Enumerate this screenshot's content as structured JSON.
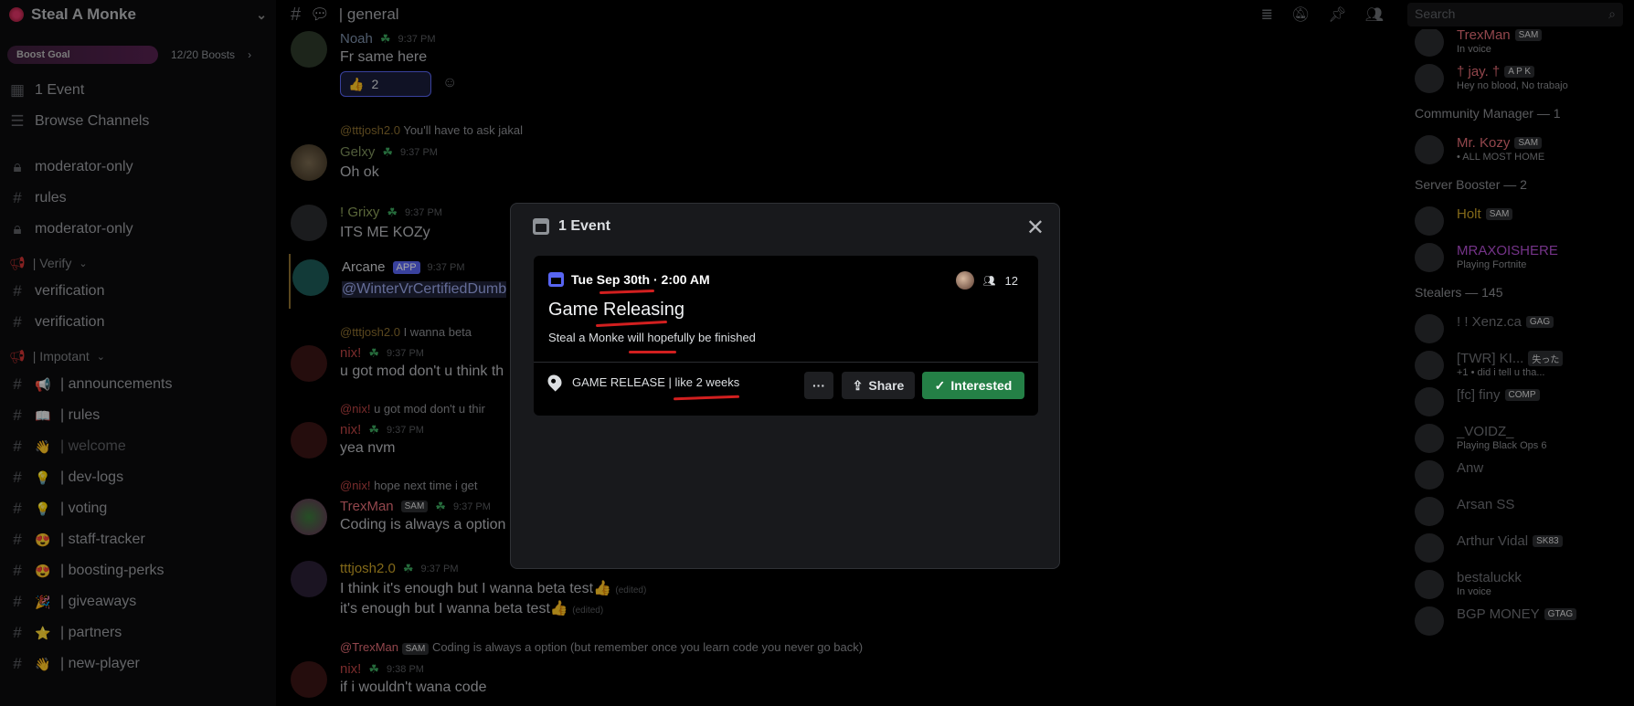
{
  "server": {
    "name": "Steal A Monke",
    "boost_label": "Boost Goal",
    "boost_count": "12/20 Boosts"
  },
  "sidebar": {
    "top_items": [
      {
        "label": "1 Event",
        "icon": "calendar-icon"
      },
      {
        "label": "Browse Channels",
        "icon": "browse-icon"
      }
    ],
    "channels_a": [
      {
        "label": "moderator-only",
        "icon": "lock-icon"
      },
      {
        "label": "rules",
        "icon": "hash-icon"
      },
      {
        "label": "moderator-only",
        "icon": "lock-icon"
      }
    ],
    "cat_verify": "| Verify",
    "channels_verify": [
      "verification",
      "verification"
    ],
    "cat_impotant": "| Impotant",
    "channels_impotant": [
      {
        "emoji": "📢",
        "label": "| announcements"
      },
      {
        "emoji": "📖",
        "label": "| rules"
      },
      {
        "emoji": "👋",
        "label": "| welcome"
      },
      {
        "emoji": "💡",
        "label": "| dev-logs"
      },
      {
        "emoji": "💡",
        "label": "| voting"
      },
      {
        "emoji": "😍",
        "label": "| staff-tracker"
      },
      {
        "emoji": "😍",
        "label": "| boosting-perks"
      },
      {
        "emoji": "🎉",
        "label": "| giveaways"
      },
      {
        "emoji": "⭐",
        "label": "| partners"
      },
      {
        "emoji": "👋",
        "label": "| new-player"
      }
    ]
  },
  "topbar": {
    "channel": "| general",
    "search_placeholder": "Search"
  },
  "messages": [
    {
      "author": "Noah",
      "time": "9:37 PM",
      "text": "Fr same here",
      "reaction_count": "2"
    },
    {
      "reply_who": "@tttjosh2.0",
      "reply_text": "You'll have to ask jakal",
      "author": "Gelxy",
      "time": "9:37 PM",
      "text": "Oh ok"
    },
    {
      "author": "! Grixy",
      "time": "9:37 PM",
      "text": "ITS ME KOZy"
    },
    {
      "author": "Arcane",
      "app": "APP",
      "time": "9:37 PM",
      "text": "@WinterVrCertifiedDumb"
    },
    {
      "reply_who": "@tttjosh2.0",
      "reply_text": "I wanna beta",
      "author": "nix!",
      "time": "9:37 PM",
      "text": "u got mod don't u think th"
    },
    {
      "reply_who": "@nix!",
      "reply_text": "u got mod don't u thir",
      "author": "nix!",
      "time": "9:37 PM",
      "text": "yea nvm"
    },
    {
      "reply_who": "@nix!",
      "reply_text": "hope next time i get",
      "author": "TrexMan",
      "badge": "SAM",
      "time": "9:37 PM",
      "text": "Coding is always a option"
    },
    {
      "author": "tttjosh2.0",
      "time": "9:37 PM",
      "text": "I think it's enough but I wanna beta test👍",
      "text2": "it's enough but I wanna beta test👍",
      "edited": "(edited)"
    },
    {
      "reply_who": "@TrexMan",
      "reply_badge": "SAM",
      "reply_text": "Coding is always a option (but remember once you learn code you never go back)",
      "author": "nix!",
      "time": "9:38 PM",
      "text": "if i wouldn't wana code"
    }
  ],
  "members": {
    "top": [
      {
        "name": "TrexMan",
        "badge": "SAM",
        "status": "In voice",
        "color": "#e06c75"
      },
      {
        "name": "† jay. †",
        "badge": "A P K",
        "status": "Hey no blood, No trabajo",
        "color": "#e06c75"
      }
    ],
    "cat_cm": "Community Manager — 1",
    "cm": [
      {
        "name": "Mr. Kozy",
        "badge": "SAM",
        "status": "• ALL MOST HOME",
        "color": "#e06c75"
      }
    ],
    "cat_booster": "Server Booster — 2",
    "boosters": [
      {
        "name": "Holt",
        "badge": "SAM",
        "status": "",
        "color": "#c9a227"
      },
      {
        "name": "MRAXOISHERE",
        "badge": "",
        "status": "Playing Fortnite",
        "color": "#b34fd1"
      }
    ],
    "cat_stealers": "Stealers — 145",
    "stealers": [
      {
        "name": "! ! Xenz.ca",
        "badge": "GAG",
        "status": ""
      },
      {
        "name": "[TWR] KI...",
        "badge": "失った",
        "status": "+1 • did i tell u tha..."
      },
      {
        "name": "[fc] finy",
        "badge": "COMP",
        "status": ""
      },
      {
        "name": "_VOIDZ_",
        "badge": "",
        "status": "Playing Black Ops 6"
      },
      {
        "name": "Anw",
        "badge": "",
        "status": ""
      },
      {
        "name": "Arsan SS",
        "badge": "",
        "status": ""
      },
      {
        "name": "Arthur Vidal",
        "badge": "SK83",
        "status": ""
      },
      {
        "name": "bestaluckk",
        "badge": "",
        "status": "In voice"
      },
      {
        "name": "BGP MONEY",
        "badge": "GTAG",
        "status": ""
      }
    ]
  },
  "modal": {
    "title": "1 Event",
    "date": "Tue Sep 30th · 2:00 AM",
    "event_title": "Game Releasing",
    "description": "Steal a Monke will hopefully be finished",
    "interested_count": "12",
    "location": "GAME RELEASE | like 2 weeks",
    "more_label": "···",
    "share_label": "Share",
    "interested_label": "Interested"
  },
  "colors": {
    "accent": "#5865f2",
    "interested": "#248046",
    "annotation": "#d21f1f"
  }
}
